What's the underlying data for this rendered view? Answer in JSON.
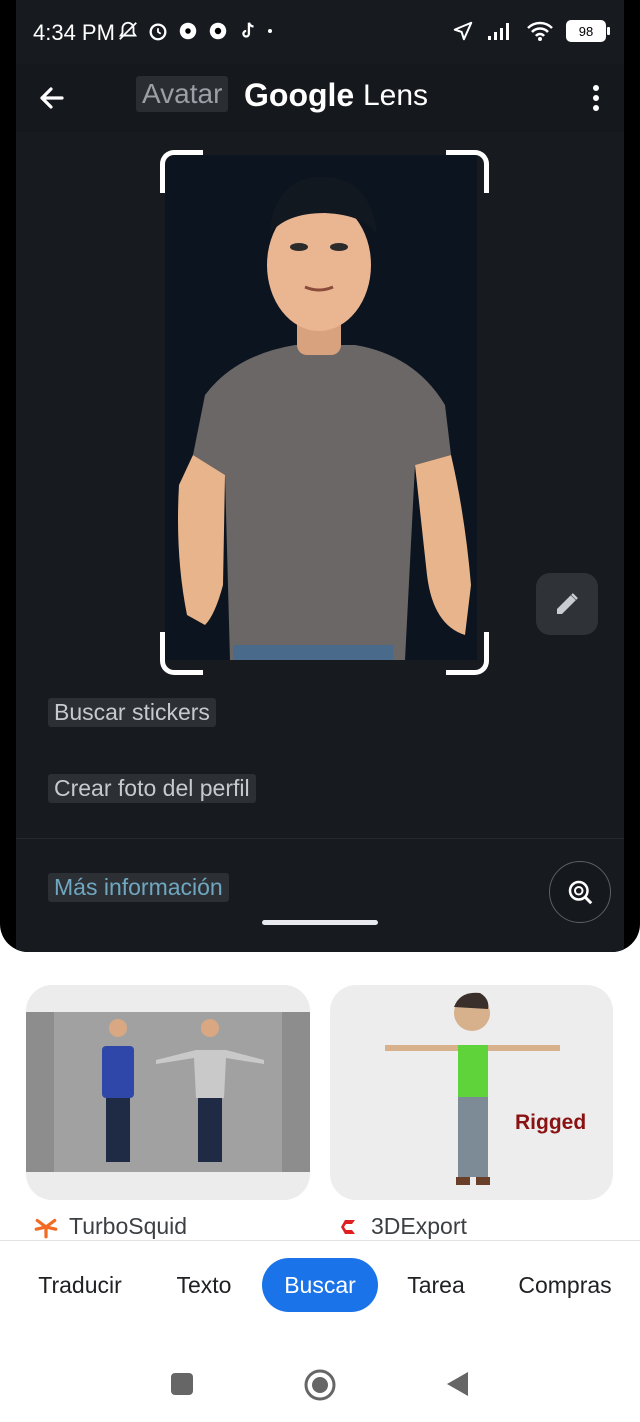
{
  "status": {
    "time": "4:34 PM",
    "battery": "98"
  },
  "appbar": {
    "search_chip": "Avatar",
    "title_brand": "Google",
    "title_product": "Lens"
  },
  "actions": {
    "stickers": "Buscar stickers",
    "profile_photo": "Crear foto del perfil",
    "more_info": "Más información"
  },
  "results": [
    {
      "source": "TurboSquid",
      "image_text": ""
    },
    {
      "source": "3DExport",
      "image_text": "Rigged"
    }
  ],
  "tabs": [
    {
      "label": "Traducir"
    },
    {
      "label": "Texto"
    },
    {
      "label": "Buscar",
      "active": true
    },
    {
      "label": "Tarea"
    },
    {
      "label": "Compras"
    }
  ],
  "colors": {
    "accent": "#1a73e8",
    "link": "#6fa7c0"
  }
}
